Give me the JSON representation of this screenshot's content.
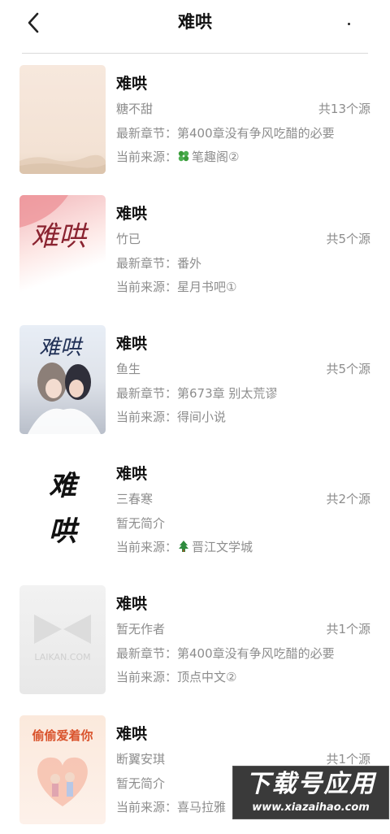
{
  "header": {
    "title": "难哄"
  },
  "books": [
    {
      "title": "难哄",
      "author": "糖不甜",
      "source_count": "共13个源",
      "line2": "最新章节：第400章没有争风吃醋的必要",
      "source": "当前来源：",
      "source_icon": "clover-icon",
      "source_name": "笔趣阁②",
      "cover": {
        "text": "",
        "style": "beige"
      }
    },
    {
      "title": "难哄",
      "author": "竹已",
      "source_count": "共5个源",
      "line2": "最新章节：番外",
      "source": "当前来源：",
      "source_icon": "",
      "source_name": "星月书吧①",
      "cover": {
        "text": "难哄",
        "style": "pink"
      }
    },
    {
      "title": "难哄",
      "author": "鱼生",
      "source_count": "共5个源",
      "line2": "最新章节：第673章 别太荒谬",
      "source": "当前来源：",
      "source_icon": "",
      "source_name": "得间小说",
      "cover": {
        "text": "难哄",
        "style": "anime"
      }
    },
    {
      "title": "难哄",
      "author": "三春寒",
      "source_count": "共2个源",
      "line2": "暂无简介",
      "source": "当前来源：",
      "source_icon": "tree-icon",
      "source_name": "晋江文学城",
      "cover": {
        "text": "难哄",
        "style": "calligraphy"
      }
    },
    {
      "title": "难哄",
      "author": "暂无作者",
      "source_count": "共1个源",
      "line2": "最新章节：第400章没有争风吃醋的必要",
      "source": "当前来源：",
      "source_icon": "",
      "source_name": "顶点中文②",
      "cover": {
        "text": "LAIKAN.COM",
        "style": "placeholder"
      }
    },
    {
      "title": "难哄",
      "author": "断翼安琪",
      "source_count": "共1个源",
      "line2": "暂无简介",
      "source": "当前来源：",
      "source_icon": "",
      "source_name": "喜马拉雅",
      "cover": {
        "text": "偷偷爱着你",
        "style": "heart"
      }
    }
  ],
  "watermark": {
    "title": "下载号应用",
    "url": "www.xiazaihao.com"
  }
}
